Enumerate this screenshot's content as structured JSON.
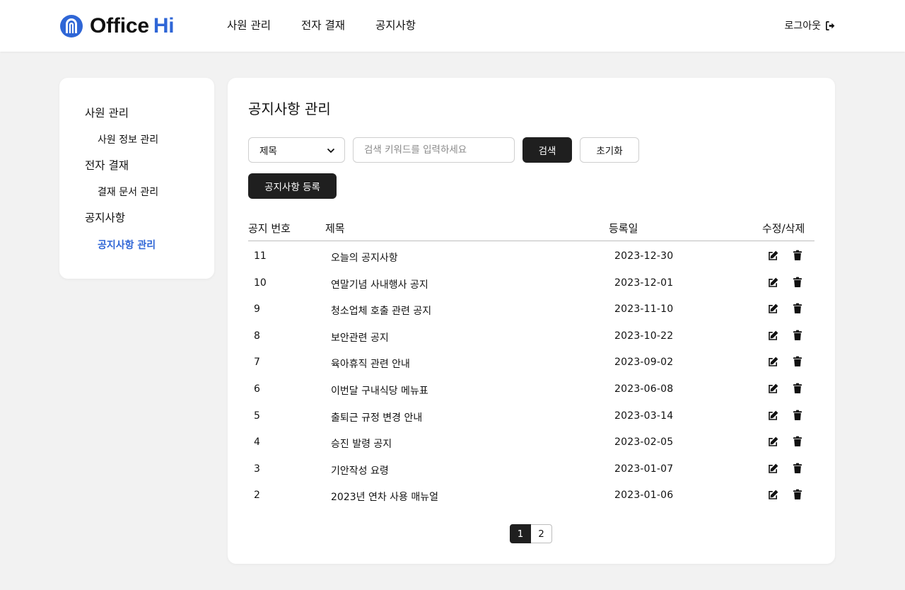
{
  "header": {
    "logo_word": "Office",
    "logo_accent": "Hi",
    "nav": [
      "사원 관리",
      "전자 결재",
      "공지사항"
    ],
    "logout_label": "로그아웃"
  },
  "sidebar": {
    "groups": [
      {
        "label": "사원 관리",
        "items": [
          "사원 정보 관리"
        ]
      },
      {
        "label": "전자 결재",
        "items": [
          "결재 문서 관리"
        ]
      },
      {
        "label": "공지사항",
        "items": [
          "공지사항 관리"
        ]
      }
    ],
    "active_item": "공지사항 관리"
  },
  "main": {
    "title": "공지사항 관리",
    "filter_selected": "제목",
    "search_placeholder": "검색 키워드를 입력하세요",
    "search_button": "검색",
    "reset_button": "초기화",
    "register_button": "공지사항 등록",
    "columns": [
      "공지 번호",
      "제목",
      "등록일",
      "수정/삭제"
    ],
    "rows": [
      {
        "no": "11",
        "title": "오늘의 공지사항",
        "date": "2023-12-30"
      },
      {
        "no": "10",
        "title": "연말기념 사내행사 공지",
        "date": "2023-12-01"
      },
      {
        "no": "9",
        "title": "청소업체 호출 관련 공지",
        "date": "2023-11-10"
      },
      {
        "no": "8",
        "title": "보안관련 공지",
        "date": "2023-10-22"
      },
      {
        "no": "7",
        "title": "육아휴직 관련 안내",
        "date": "2023-09-02"
      },
      {
        "no": "6",
        "title": "이번달 구내식당 메뉴표",
        "date": "2023-06-08"
      },
      {
        "no": "5",
        "title": "출퇴근 규정 변경 안내",
        "date": "2023-03-14"
      },
      {
        "no": "4",
        "title": "승진 발령 공지",
        "date": "2023-02-05"
      },
      {
        "no": "3",
        "title": "기안작성 요령",
        "date": "2023-01-07"
      },
      {
        "no": "2",
        "title": "2023년 연차 사용 매뉴얼",
        "date": "2023-01-06"
      }
    ],
    "pages": [
      "1",
      "2"
    ],
    "current_page": "1"
  },
  "colors": {
    "accent": "#2f66d6",
    "dark_button": "#1f1f1f",
    "background": "#f2f2f2"
  }
}
